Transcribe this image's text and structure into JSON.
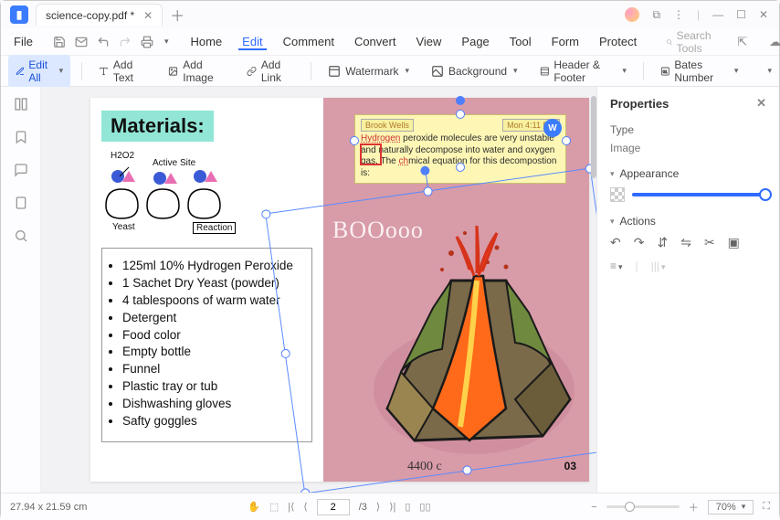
{
  "title": {
    "tab": "science-copy.pdf *"
  },
  "menu": {
    "file": "File",
    "items": [
      "Home",
      "Edit",
      "Comment",
      "Convert",
      "View",
      "Page",
      "Tool",
      "Form",
      "Protect"
    ],
    "active": "Edit",
    "search_placeholder": "Search Tools"
  },
  "toolbar": {
    "editall": "Edit All",
    "add_text": "Add Text",
    "add_image": "Add Image",
    "add_link": "Add Link",
    "watermark": "Watermark",
    "background": "Background",
    "header_footer": "Header & Footer",
    "bates": "Bates Number"
  },
  "doc": {
    "materials_heading": "Materials:",
    "labels": {
      "h2o2": "H2O2",
      "active_site": "Active Site",
      "yeast": "Yeast",
      "reaction": "Reaction"
    },
    "list": [
      "125ml 10% Hydrogen Peroxide",
      "1 Sachet Dry Yeast (powder)",
      "4 tablespoons of warm water",
      "Detergent",
      "Food color",
      "Empty bottle",
      "Funnel",
      "Plastic tray or tub",
      "Dishwashing gloves",
      "Safty goggles"
    ],
    "note": {
      "author": "Brook Wells",
      "time": "Mon 4:11 PM",
      "line1a": "Hydrogen",
      "line1b": " peroxide molecules are very unstable and naturally decompose into water and oxygen gas. The ",
      "line1c": "ch",
      "line1d": "mical equation for this decompostion is:"
    },
    "boo": "BOOooo",
    "coords": "4400 c",
    "page_number": "03"
  },
  "props": {
    "title": "Properties",
    "type_label": "Type",
    "type_value": "Image",
    "appearance": "Appearance",
    "actions": "Actions"
  },
  "status": {
    "dims": "27.94 x 21.59 cm",
    "page_current": "2",
    "page_total": "/3",
    "zoom": "70%"
  }
}
